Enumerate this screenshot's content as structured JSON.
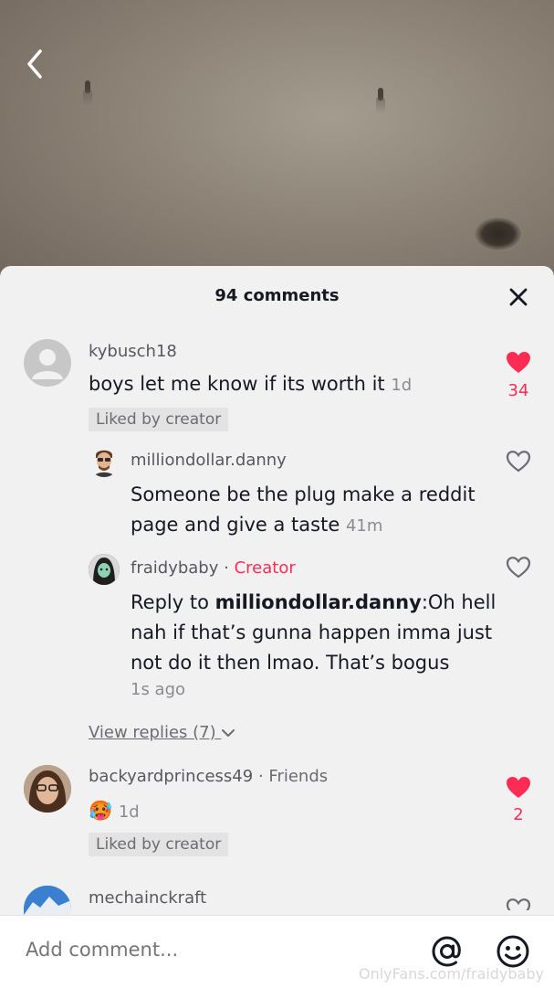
{
  "header": {
    "comment_count_label": "94 comments"
  },
  "comments": [
    {
      "username": "kybusch18",
      "text": "boys let me know if its worth it",
      "time": "1d",
      "liked_tag": "Liked by creator",
      "likes": "34",
      "liked": true
    },
    {
      "username": "backyardprincess49",
      "badge": "Friends",
      "emoji": "🥵",
      "time": "1d",
      "liked_tag": "Liked by creator",
      "likes": "2",
      "liked": true
    },
    {
      "username": "mechainckraft"
    }
  ],
  "replies": [
    {
      "username": "milliondollar.danny",
      "text": "Someone be the plug make a reddit page and give a taste",
      "time": "41m"
    },
    {
      "username": "fraidybaby",
      "badge": "Creator",
      "reply_prefix": "Reply to ",
      "mention": "milliondollar.danny",
      "text": ":Oh hell nah if that’s gunna happen imma just not do it then lmao. That’s bogus",
      "time": "1s ago"
    }
  ],
  "view_replies_label": "View replies (7)",
  "input": {
    "placeholder": "Add comment..."
  },
  "watermark": "OnlyFans.com/fraidybaby",
  "colors": {
    "accent": "#fe2c55",
    "sheet": "#f1f1f1"
  },
  "icons": [
    "back-icon",
    "close-icon",
    "heart-filled-icon",
    "heart-outline-icon",
    "at-icon",
    "emoji-icon",
    "chevron-down-icon"
  ]
}
